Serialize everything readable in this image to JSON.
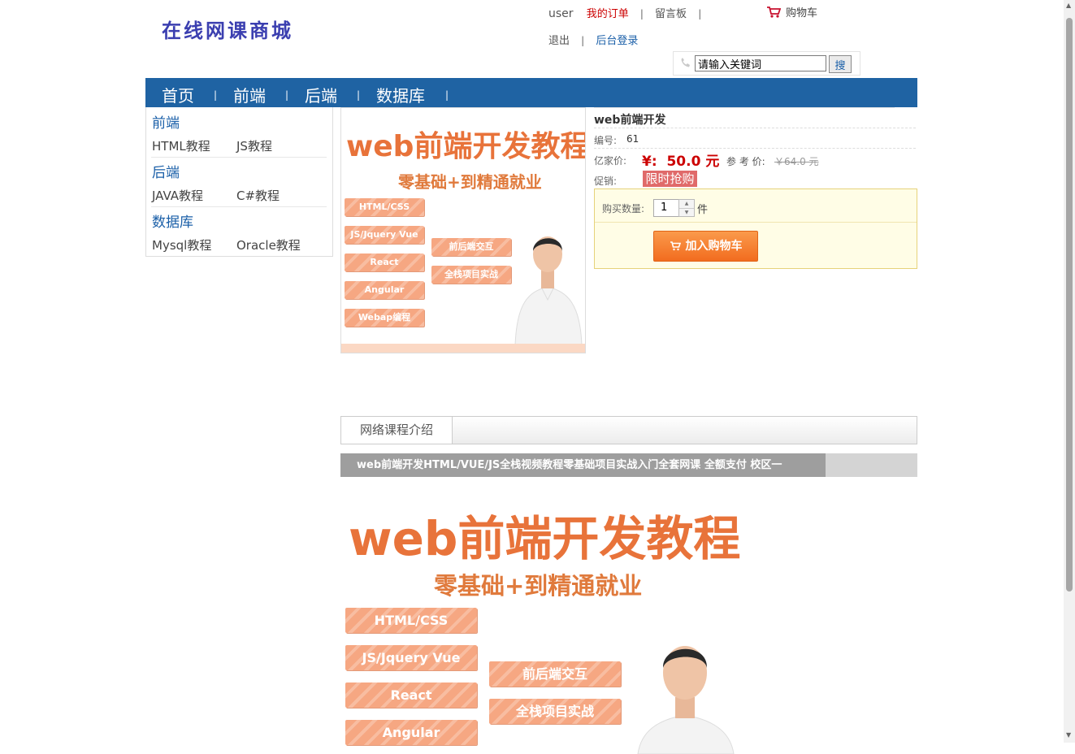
{
  "header": {
    "logo": "在线网课商城",
    "user": "user",
    "my_orders": "我的订单",
    "guestbook": "留言板",
    "sep": "|",
    "logout": "退出",
    "admin_login": "后台登录",
    "cart": "购物车",
    "search_placeholder": "请输入关键词",
    "search_button": "搜"
  },
  "nav": {
    "items": [
      "首页",
      "前端",
      "后端",
      "数据库"
    ],
    "sep": "|"
  },
  "sidebar": {
    "categories": [
      {
        "name": "前端",
        "subs": [
          "HTML教程",
          "JS教程"
        ]
      },
      {
        "name": "后端",
        "subs": [
          "JAVA教程",
          "C#教程"
        ]
      },
      {
        "name": "数据库",
        "subs": [
          "Mysql教程",
          "Oracle教程"
        ]
      }
    ]
  },
  "poster": {
    "title": "web前端开发教程",
    "subtitle": "零基础+到精通就业",
    "tags_left": [
      "HTML/CSS",
      "JS/Jquery Vue",
      "React",
      "Angular",
      "Webap编程"
    ],
    "tags_right": [
      "前后端交互",
      "全栈项目实战"
    ]
  },
  "product": {
    "title": "web前端开发",
    "code_label": "编号:",
    "code": "61",
    "price_label": "亿家价:",
    "price": "¥:  50.0 元",
    "ref_label": "参 考 价:",
    "ref_price": "￥64.0 元",
    "promo_label": "促销:",
    "promo": "限时抢购",
    "qty_label": "购买数量:",
    "qty": "1",
    "unit": "件",
    "add_cart": "加入购物车"
  },
  "detail": {
    "tab": "网络课程介绍",
    "desc_title": "web前端开发HTML/VUE/JS全栈视频教程零基础项目实战入门全套网课 全额支付 校区一"
  },
  "colors": {
    "nav_bg": "#1f63a3",
    "link_blue": "#1a5fa8",
    "price_red": "#cc0000",
    "poster_orange": "#e8733a",
    "button_orange": "#f26c1f"
  }
}
